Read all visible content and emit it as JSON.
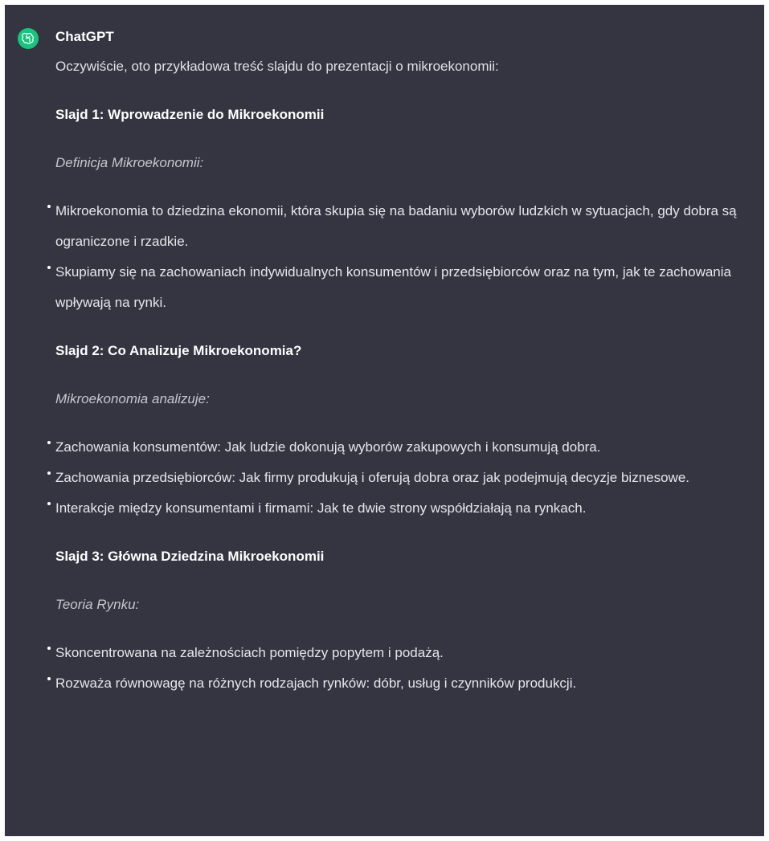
{
  "message": {
    "author": "ChatGPT",
    "avatar_icon": "openai-logo-icon",
    "avatar_color": "#19c37d",
    "background": "#343541",
    "intro": "Oczywiście, oto przykładowa treść slajdu do prezentacji o mikroekonomii:",
    "slides": [
      {
        "title": "Slajd 1: Wprowadzenie do Mikroekonomii",
        "subheading": "Definicja Mikroekonomii:",
        "bullets": [
          "Mikroekonomia to dziedzina ekonomii, która skupia się na badaniu wyborów ludzkich w sytuacjach, gdy dobra są ograniczone i rzadkie.",
          "Skupiamy się na zachowaniach indywidualnych konsumentów i przedsiębiorców oraz na tym, jak te zachowania wpływają na rynki."
        ]
      },
      {
        "title": "Slajd 2: Co Analizuje Mikroekonomia?",
        "subheading": "Mikroekonomia analizuje:",
        "bullets": [
          "Zachowania konsumentów: Jak ludzie dokonują wyborów zakupowych i konsumują dobra.",
          "Zachowania przedsiębiorców: Jak firmy produkują i oferują dobra oraz jak podejmują decyzje biznesowe.",
          "Interakcje między konsumentami i firmami: Jak te dwie strony współdziałają na rynkach."
        ]
      },
      {
        "title": "Slajd 3: Główna Dziedzina Mikroekonomii",
        "subheading": "Teoria Rynku:",
        "bullets": [
          "Skoncentrowana na zależnościach pomiędzy popytem i podażą.",
          "Rozważa równowagę na różnych rodzajach rynków: dóbr, usług i czynników produkcji."
        ]
      }
    ]
  }
}
